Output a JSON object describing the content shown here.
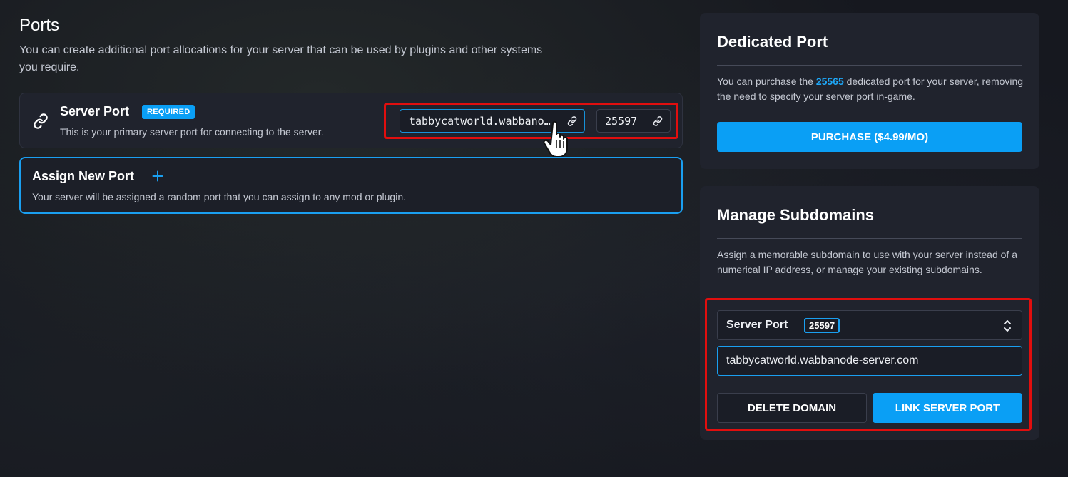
{
  "ports": {
    "title": "Ports",
    "description": "You can create additional port allocations for your server that can be used by plugins and other systems you require.",
    "server_port": {
      "title": "Server Port",
      "badge": "REQUIRED",
      "description": "This is your primary server port for connecting to the server.",
      "address": "tabbycatworld.wabbanode-server.com",
      "port": "25597",
      "icons": [
        "link-icon",
        "hand-cursor-icon"
      ]
    },
    "assign_new": {
      "title": "Assign New Port",
      "description": "Your server will be assigned a random port that you can assign to any mod or plugin.",
      "icon": "plus-icon"
    }
  },
  "dedicated_port": {
    "title": "Dedicated Port",
    "desc_before": "You can purchase the ",
    "desc_port": "25565",
    "desc_after": " dedicated port for your server, removing the need to specify your server port in-game.",
    "purchase_label": "PURCHASE ($4.99/MO)"
  },
  "manage_subdomains": {
    "title": "Manage Subdomains",
    "description": "Assign a memorable subdomain to use with your server instead of a numerical IP address, or manage your existing subdomains.",
    "select_label": "Server Port",
    "select_value": "25597",
    "domain_value": "tabbycatworld.wabbanode-server.com",
    "delete_label": "DELETE DOMAIN",
    "link_label": "LINK SERVER PORT"
  },
  "colors": {
    "accent": "#0a9ff5",
    "highlight_box": "#e10e0e",
    "card_bg": "#20232d",
    "page_bg": "#16181f"
  }
}
